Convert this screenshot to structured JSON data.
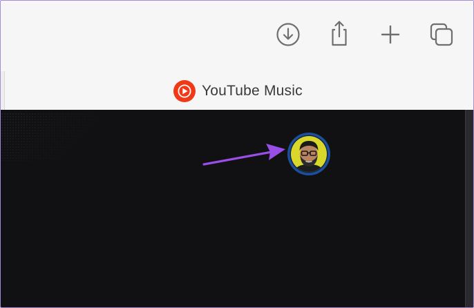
{
  "tab": {
    "label": "YouTube Music",
    "logo_icon": "youtube-music-logo-icon"
  },
  "toolbar": {
    "buttons": [
      {
        "name": "downloads-button",
        "icon": "download-circle-icon"
      },
      {
        "name": "share-button",
        "icon": "share-icon"
      },
      {
        "name": "new-tab-button",
        "icon": "plus-icon"
      },
      {
        "name": "tab-overview-button",
        "icon": "tabs-icon"
      }
    ]
  },
  "page": {
    "profile_icon": "profile-avatar-icon"
  },
  "colors": {
    "toolbar_bg": "#f6f6f6",
    "content_bg": "#111114",
    "yt_red": "#f03a17",
    "arrow": "#9a4ee8",
    "avatar_ring": "#1e4f9a",
    "avatar_face_bg": "#d9d72a"
  }
}
